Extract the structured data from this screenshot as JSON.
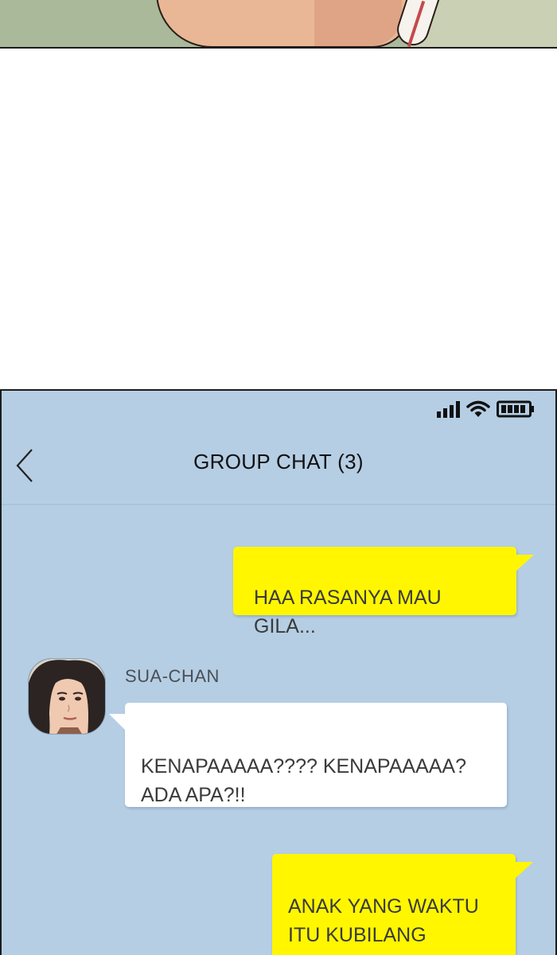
{
  "status_bar": {
    "signal_icon": "cellular-signal-icon",
    "wifi_icon": "wifi-icon",
    "battery_icon": "battery-icon"
  },
  "header": {
    "back_icon": "chevron-left-icon",
    "title": "GROUP CHAT (3)"
  },
  "messages": [
    {
      "direction": "outgoing",
      "text": "HAA RASANYA MAU\nGILA..."
    },
    {
      "direction": "incoming",
      "sender": "SUA-CHAN",
      "avatar": "user-avatar",
      "text": "KENAPAAAAA???? KENAPAAAAA?\nADA APA?!!"
    },
    {
      "direction": "outgoing",
      "text": "ANAK YANG WAKTU\nITU KUBILANG\nMENIRU AKU..."
    }
  ],
  "colors": {
    "chat_background": "#b5cee4",
    "outgoing_bubble": "#fff600",
    "incoming_bubble": "#ffffff",
    "title_text": "#111111",
    "message_text": "#3a3a3a"
  }
}
